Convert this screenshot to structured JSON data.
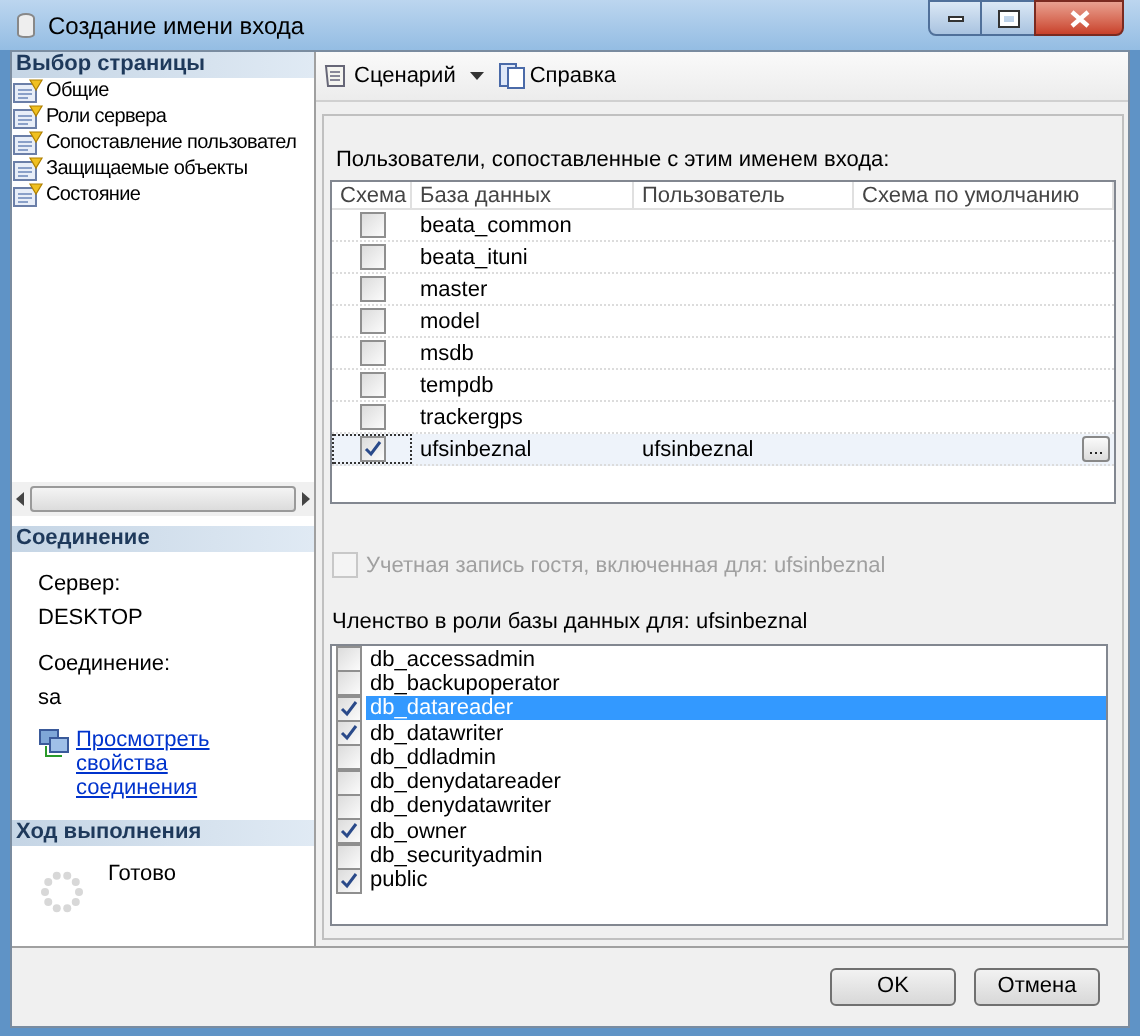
{
  "window": {
    "title": "Создание имени входа"
  },
  "sidebar": {
    "title": "Выбор страницы",
    "items": [
      {
        "label": "Общие",
        "selected": false
      },
      {
        "label": "Роли сервера",
        "selected": false
      },
      {
        "label": "Сопоставление пользовател",
        "selected": false
      },
      {
        "label": "Защищаемые объекты",
        "selected": false
      },
      {
        "label": "Состояние",
        "selected": false
      }
    ]
  },
  "connection": {
    "title": "Соединение",
    "server_label": "Сервер:",
    "server": "DESKTOP",
    "login_label": "Соединение:",
    "login": "sa",
    "link": "Просмотреть свойства соединения"
  },
  "progress": {
    "title": "Ход выполнения",
    "status": "Готово"
  },
  "toolbar": {
    "script": "Сценарий",
    "help": "Справка"
  },
  "users_label": "Пользователи, сопоставленные с этим именем входа:",
  "table": {
    "columns": [
      "Схема",
      "База данных",
      "Пользователь",
      "Схема по умолчанию"
    ],
    "rows": [
      {
        "checked": false,
        "selected": false,
        "database": "beata_common"
      },
      {
        "checked": false,
        "selected": false,
        "database": "beata_ituni"
      },
      {
        "checked": false,
        "selected": false,
        "database": "master"
      },
      {
        "checked": false,
        "selected": false,
        "database": "model"
      },
      {
        "checked": false,
        "selected": false,
        "database": "msdb"
      },
      {
        "checked": false,
        "selected": false,
        "database": "tempdb"
      },
      {
        "checked": false,
        "selected": false,
        "database": "trackergps"
      },
      {
        "checked": true,
        "selected": true,
        "database": "ufsinbeznal",
        "user": "ufsinbeznal",
        "browse": "..."
      }
    ]
  },
  "guest": {
    "label": "Учетная запись гостя, включенная для: ufsinbeznal",
    "checked": false,
    "disabled": true
  },
  "roles_label": "Членство в роли базы данных для: ufsinbeznal",
  "roles": [
    {
      "name": "db_accessadmin",
      "checked": false,
      "selected": false
    },
    {
      "name": "db_backupoperator",
      "checked": false,
      "selected": false
    },
    {
      "name": "db_datareader",
      "checked": true,
      "selected": true
    },
    {
      "name": "db_datawriter",
      "checked": true,
      "selected": false
    },
    {
      "name": "db_ddladmin",
      "checked": false,
      "selected": false
    },
    {
      "name": "db_denydatareader",
      "checked": false,
      "selected": false
    },
    {
      "name": "db_denydatawriter",
      "checked": false,
      "selected": false
    },
    {
      "name": "db_owner",
      "checked": true,
      "selected": false
    },
    {
      "name": "db_securityadmin",
      "checked": false,
      "selected": false
    },
    {
      "name": "public",
      "checked": true,
      "selected": false
    }
  ],
  "buttons": [
    "OK",
    "Отмена"
  ]
}
